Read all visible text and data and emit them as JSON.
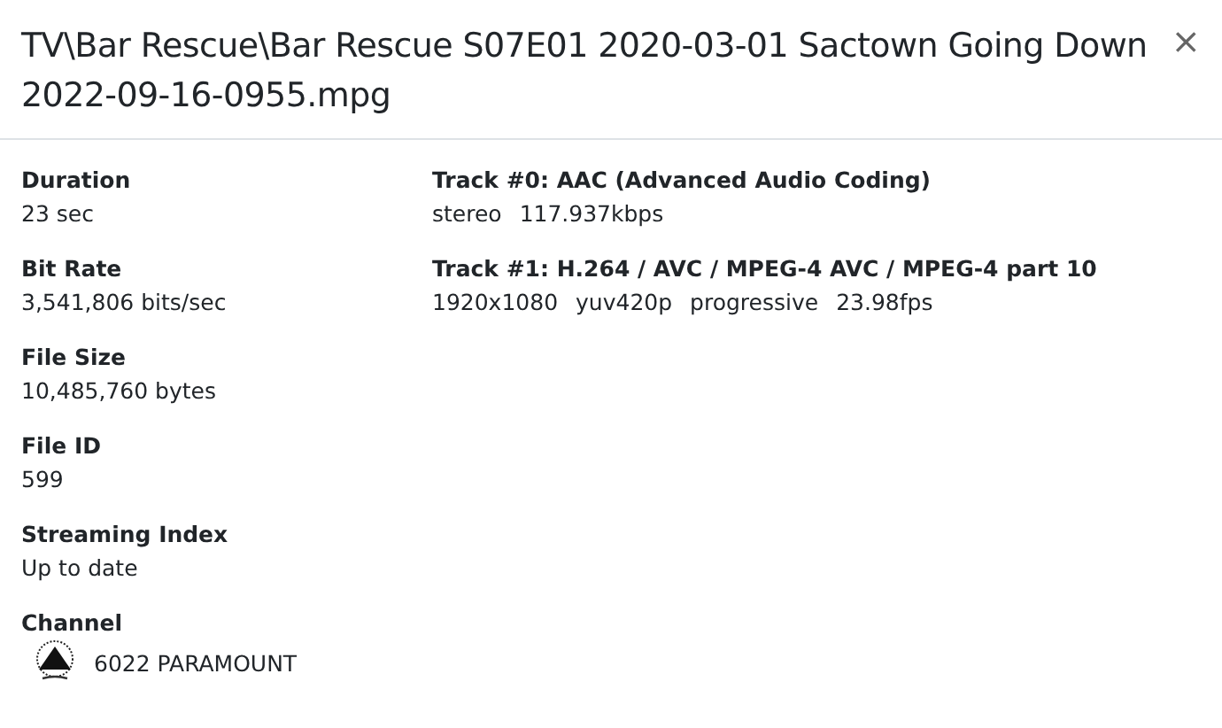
{
  "dialog": {
    "title": "TV\\Bar Rescue\\Bar Rescue S07E01 2020-03-01 Sactown Going Down 2022-09-16-0955.mpg",
    "close": "×"
  },
  "properties": [
    {
      "label": "Duration",
      "value": "23 sec"
    },
    {
      "label": "Bit Rate",
      "value": "3,541,806 bits/sec"
    },
    {
      "label": "File Size",
      "value": "10,485,760 bytes"
    },
    {
      "label": "File ID",
      "value": "599"
    },
    {
      "label": "Streaming Index",
      "value": "Up to date"
    }
  ],
  "channel": {
    "label": "Channel",
    "name": "6022 PARAMOUNT"
  },
  "tracks": [
    {
      "title": "Track #0: AAC (Advanced Audio Coding)",
      "details": [
        "stereo",
        "117.937kbps"
      ]
    },
    {
      "title": "Track #1: H.264 / AVC / MPEG-4 AVC / MPEG-4 part 10",
      "details": [
        "1920x1080",
        "yuv420p",
        "progressive",
        "23.98fps"
      ]
    }
  ]
}
